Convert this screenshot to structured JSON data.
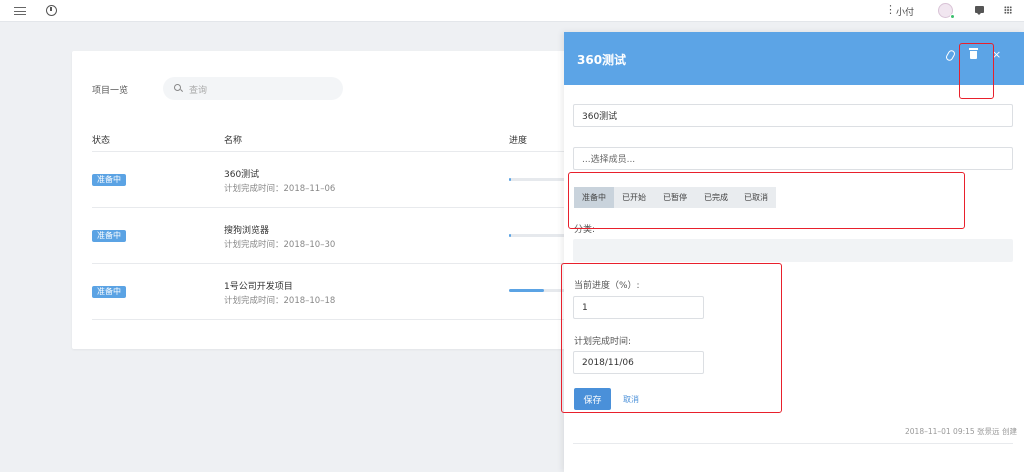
{
  "topbar": {
    "user_menu_glyph": "⋮",
    "user_name": "小付"
  },
  "list": {
    "title": "项目一览",
    "search_placeholder": "查询",
    "columns": [
      "状态",
      "名称",
      "进度"
    ],
    "rows": [
      {
        "status": "准备中",
        "name": "360测试",
        "date": "计划完成时间：2018–11–06",
        "progress": 1
      },
      {
        "status": "准备中",
        "name": "搜狗浏览器",
        "date": "计划完成时间：2018–10–30",
        "progress": 1
      },
      {
        "status": "准备中",
        "name": "1号公司开发项目",
        "date": "计划完成时间：2018–10–18",
        "progress": 42
      }
    ]
  },
  "panel": {
    "title": "360测试",
    "close_glyph": "×",
    "name_value": "360测试",
    "member_placeholder": "...选择成员...",
    "status_tabs": [
      "准备中",
      "已开始",
      "已暂停",
      "已完成",
      "已取消"
    ],
    "active_status": "准备中",
    "category_label": "分类:",
    "progress_label": "当前进度（%）:",
    "progress_value": "1",
    "date_label": "计划完成时间:",
    "date_value": "2018/11/06",
    "save_label": "保存",
    "cancel_label": "取消",
    "meta": "2018–11–01 09:15 张景远 创建"
  },
  "colors": {
    "accent": "#5ca4e6",
    "badge": "#5ba3e4",
    "highlight": "#e8202c"
  }
}
